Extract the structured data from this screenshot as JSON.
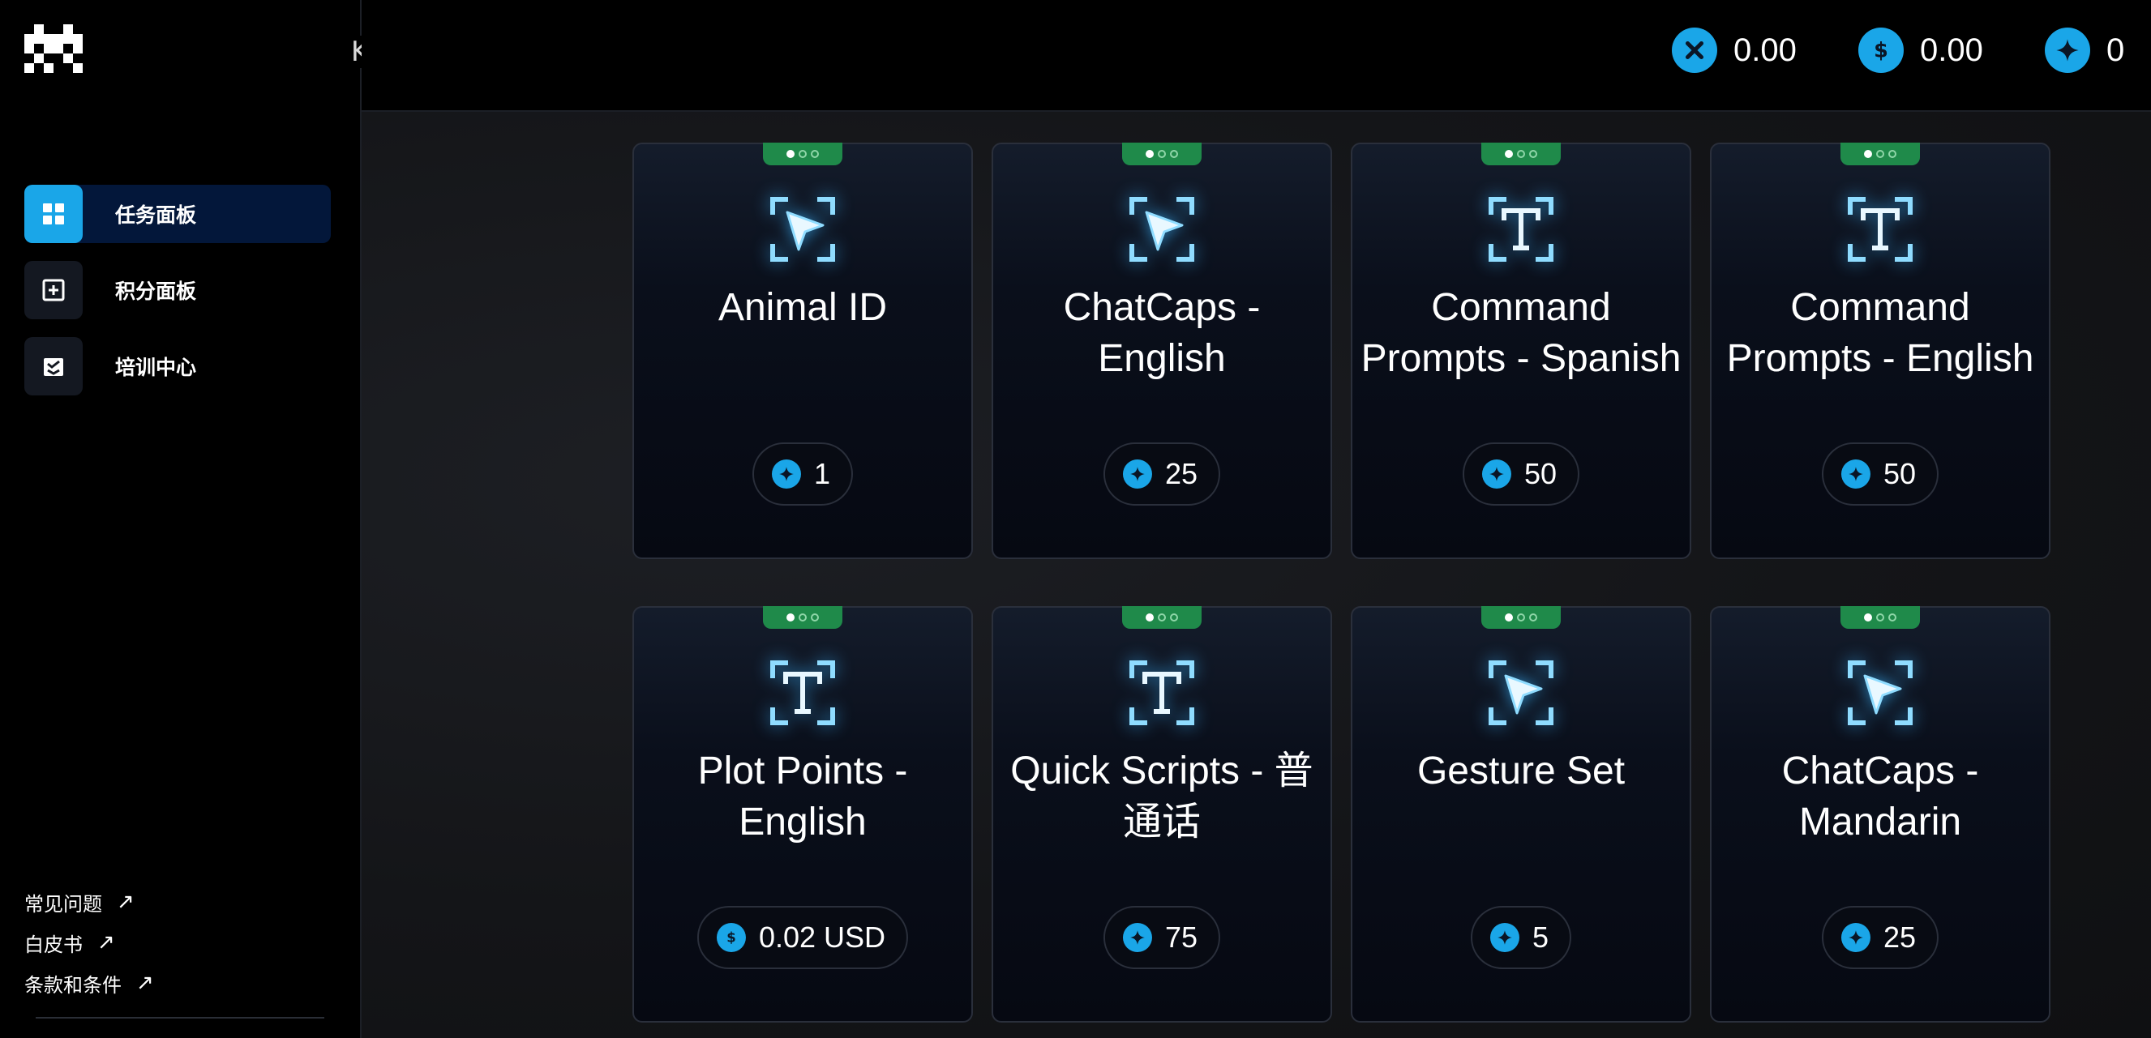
{
  "sidebar": {
    "collapse_glyph": "K",
    "nav": [
      {
        "label": "任务面板",
        "icon": "grid-icon",
        "active": true
      },
      {
        "label": "积分面板",
        "icon": "plus-square-icon",
        "active": false
      },
      {
        "label": "培训中心",
        "icon": "training-icon",
        "active": false
      }
    ],
    "links": [
      {
        "label": "常见问题",
        "arrow": "↗"
      },
      {
        "label": "白皮书",
        "arrow": "↗"
      },
      {
        "label": "条款和条件",
        "arrow": "↗"
      }
    ]
  },
  "topbar": {
    "balances": [
      {
        "icon": "x-coin-icon",
        "value": "0.00"
      },
      {
        "icon": "dollar-coin-icon",
        "value": "0.00"
      },
      {
        "icon": "star-coin-icon",
        "value": "0"
      }
    ]
  },
  "cards": [
    {
      "title": "Animal ID",
      "icon": "cursor-icon",
      "reward": "1",
      "reward_icon": "star-coin-icon"
    },
    {
      "title": "ChatCaps - English",
      "icon": "cursor-icon",
      "reward": "25",
      "reward_icon": "star-coin-icon"
    },
    {
      "title": "Command Prompts - Spanish",
      "icon": "text-icon",
      "reward": "50",
      "reward_icon": "star-coin-icon"
    },
    {
      "title": "Command Prompts - English",
      "icon": "text-icon",
      "reward": "50",
      "reward_icon": "star-coin-icon"
    },
    {
      "title": "Plot Points - English",
      "icon": "text-icon",
      "reward": "0.02 USD",
      "reward_icon": "dollar-coin-icon"
    },
    {
      "title": "Quick Scripts - 普通话",
      "icon": "text-icon",
      "reward": "75",
      "reward_icon": "star-coin-icon"
    },
    {
      "title": "Gesture Set",
      "icon": "cursor-icon",
      "reward": "5",
      "reward_icon": "star-coin-icon"
    },
    {
      "title": "ChatCaps - Mandarin",
      "icon": "cursor-icon",
      "reward": "25",
      "reward_icon": "star-coin-icon"
    }
  ],
  "colors": {
    "accent": "#1aa6e8",
    "tab_green": "#1f8a4a",
    "active_nav": "#03173a"
  }
}
